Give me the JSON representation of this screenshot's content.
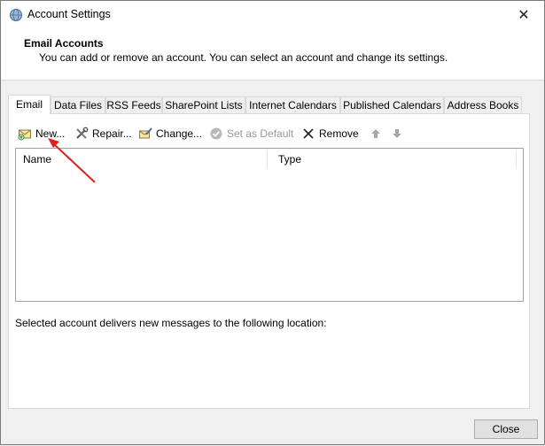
{
  "window": {
    "title": "Account Settings",
    "close_label": "✕"
  },
  "header": {
    "title": "Email Accounts",
    "subtitle": "You can add or remove an account. You can select an account and change its settings."
  },
  "tabs": [
    {
      "label": "Email",
      "active": true
    },
    {
      "label": "Data Files"
    },
    {
      "label": "RSS Feeds"
    },
    {
      "label": "SharePoint Lists"
    },
    {
      "label": "Internet Calendars"
    },
    {
      "label": "Published Calendars"
    },
    {
      "label": "Address Books"
    }
  ],
  "toolbar": {
    "new_label": "New...",
    "repair_label": "Repair...",
    "change_label": "Change...",
    "set_default_label": "Set as Default",
    "remove_label": "Remove"
  },
  "list": {
    "columns": [
      "Name",
      "Type"
    ],
    "rows": []
  },
  "location_text": "Selected account delivers new messages to the following location:",
  "footer": {
    "close_label": "Close"
  },
  "colors": {
    "annotation_arrow": "#e02020",
    "disabled_text": "#9a9a9a"
  }
}
